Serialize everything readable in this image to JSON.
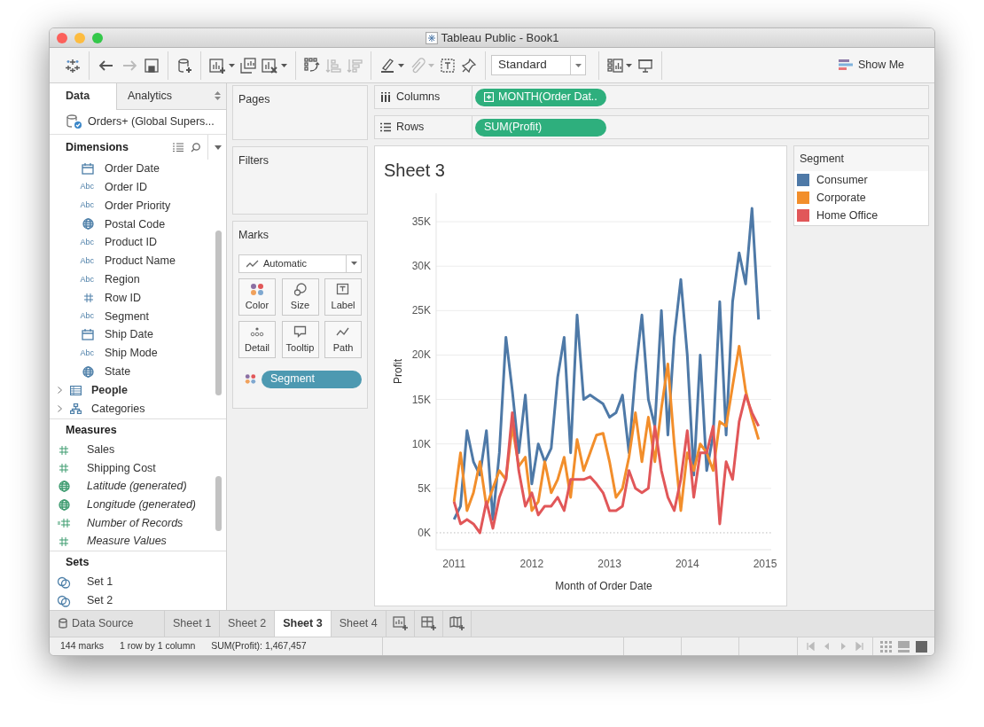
{
  "window": {
    "title": "Tableau Public - Book1"
  },
  "toolbar": {
    "groups": [
      [
        {
          "disabled": false,
          "menu": false
        }
      ],
      [
        {
          "disabled": false,
          "menu": false
        },
        {
          "disabled": true,
          "menu": false
        },
        {
          "disabled": false,
          "menu": false
        }
      ],
      [
        {
          "disabled": false,
          "menu": false
        }
      ],
      [
        {
          "disabled": false,
          "menu": true
        },
        {
          "disabled": false,
          "menu": false
        },
        {
          "disabled": false,
          "menu": true
        }
      ],
      [
        {
          "disabled": false,
          "menu": false
        },
        {
          "disabled": true,
          "menu": false
        },
        {
          "disabled": true,
          "menu": false
        }
      ],
      [
        {
          "disabled": false,
          "menu": true
        },
        {
          "disabled": true,
          "menu": true
        },
        {
          "disabled": false,
          "menu": false
        },
        {
          "disabled": false,
          "menu": false
        }
      ]
    ],
    "fit": {
      "value": "Standard"
    },
    "view_buttons": [
      {
        "disabled": false,
        "menu": true
      },
      {
        "disabled": false,
        "menu": false
      }
    ],
    "show_me": {
      "label": "Show Me"
    }
  },
  "data_pane": {
    "tabs": [
      {
        "label": "Data",
        "selected": true
      },
      {
        "label": "Analytics",
        "selected": false
      }
    ],
    "datasource": "Orders+ (Global Supers...",
    "dimensions": {
      "title": "Dimensions",
      "fields": [
        {
          "name": "Order Date",
          "kind": "date"
        },
        {
          "name": "Order ID",
          "kind": "string",
          "badge": "Abc"
        },
        {
          "name": "Order Priority",
          "kind": "string",
          "badge": "Abc"
        },
        {
          "name": "Postal Code",
          "kind": "geo"
        },
        {
          "name": "Product ID",
          "kind": "string",
          "badge": "Abc"
        },
        {
          "name": "Product Name",
          "kind": "string",
          "badge": "Abc"
        },
        {
          "name": "Region",
          "kind": "string",
          "badge": "Abc"
        },
        {
          "name": "Row ID",
          "kind": "number"
        },
        {
          "name": "Segment",
          "kind": "string",
          "badge": "Abc"
        },
        {
          "name": "Ship Date",
          "kind": "date"
        },
        {
          "name": "Ship Mode",
          "kind": "string",
          "badge": "Abc"
        },
        {
          "name": "State",
          "kind": "geo"
        },
        {
          "name": "People",
          "kind": "folder",
          "expanded": false
        },
        {
          "name": "Categories",
          "kind": "hierarchy",
          "expanded": false
        }
      ]
    },
    "measures": {
      "title": "Measures",
      "fields": [
        {
          "name": "Sales",
          "kind": "number",
          "italic": false
        },
        {
          "name": "Shipping Cost",
          "kind": "number",
          "italic": false
        },
        {
          "name": "Latitude (generated)",
          "kind": "geo",
          "italic": true
        },
        {
          "name": "Longitude (generated)",
          "kind": "geo",
          "italic": true
        },
        {
          "name": "Number of Records",
          "kind": "count",
          "italic": true
        },
        {
          "name": "Measure Values",
          "kind": "number",
          "italic": true
        }
      ]
    },
    "sets": {
      "title": "Sets",
      "items": [
        {
          "name": "Set 1"
        },
        {
          "name": "Set 2"
        }
      ]
    }
  },
  "shelves": {
    "pages": {
      "title": "Pages"
    },
    "filters": {
      "title": "Filters"
    },
    "marks": {
      "title": "Marks",
      "mark_type": "Automatic",
      "cards": [
        {
          "label": "Color",
          "kind": "color"
        },
        {
          "label": "Size",
          "kind": "size"
        },
        {
          "label": "Label",
          "kind": "label"
        },
        {
          "label": "Detail",
          "kind": "detail"
        },
        {
          "label": "Tooltip",
          "kind": "tooltip"
        },
        {
          "label": "Path",
          "kind": "path"
        }
      ],
      "pills": [
        {
          "label": "Segment",
          "kind": "color"
        }
      ]
    },
    "columns": {
      "label": "Columns",
      "pills": [
        {
          "label": "MONTH(Order Dat..",
          "expandable": true
        }
      ]
    },
    "rows": {
      "label": "Rows",
      "pills": [
        {
          "label": "SUM(Profit)",
          "expandable": false
        }
      ]
    }
  },
  "sheet": {
    "title": "Sheet 3",
    "chart_data": {
      "type": "line",
      "xlabel": "Month of Order Date",
      "ylabel": "Profit",
      "x": [
        2011,
        2011.083,
        2011.167,
        2011.25,
        2011.333,
        2011.417,
        2011.5,
        2011.583,
        2011.667,
        2011.75,
        2011.833,
        2011.917,
        2012,
        2012.083,
        2012.167,
        2012.25,
        2012.333,
        2012.417,
        2012.5,
        2012.583,
        2012.667,
        2012.75,
        2012.833,
        2012.917,
        2013,
        2013.083,
        2013.167,
        2013.25,
        2013.333,
        2013.417,
        2013.5,
        2013.583,
        2013.667,
        2013.75,
        2013.833,
        2013.917,
        2014,
        2014.083,
        2014.167,
        2014.25,
        2014.333,
        2014.417,
        2014.5,
        2014.583,
        2014.667,
        2014.75,
        2014.833,
        2014.917
      ],
      "series": [
        {
          "name": "Consumer",
          "color": "#4e79a7",
          "values": [
            1500,
            3000,
            11500,
            8000,
            6500,
            11500,
            1500,
            9000,
            22000,
            16000,
            9000,
            15500,
            5500,
            10000,
            8000,
            9500,
            17500,
            22000,
            9000,
            24500,
            15000,
            15500,
            15000,
            14500,
            13000,
            13500,
            15500,
            9000,
            18000,
            24500,
            15000,
            12000,
            25000,
            11000,
            22000,
            28500,
            20000,
            6500,
            20000,
            7000,
            11000,
            26000,
            11000,
            26000,
            31500,
            28000,
            36500,
            24000
          ]
        },
        {
          "name": "Corporate",
          "color": "#f28e2b",
          "values": [
            3500,
            9000,
            2500,
            4500,
            8000,
            3000,
            5000,
            7000,
            6000,
            12000,
            7500,
            8500,
            2500,
            3500,
            8000,
            4500,
            6000,
            8500,
            4000,
            10500,
            7000,
            9000,
            11000,
            11200,
            8000,
            4000,
            5000,
            8500,
            13500,
            8000,
            13000,
            8000,
            14000,
            19000,
            10000,
            2500,
            9000,
            7000,
            10000,
            9000,
            7000,
            12500,
            12000,
            16500,
            21000,
            16000,
            13000,
            10500
          ]
        },
        {
          "name": "Home Office",
          "color": "#e15759",
          "values": [
            3500,
            1000,
            1500,
            1000,
            0,
            3500,
            500,
            4000,
            6000,
            13500,
            7000,
            3000,
            4500,
            2000,
            3000,
            3000,
            4000,
            2500,
            6000,
            6000,
            6000,
            6300,
            5500,
            4500,
            2500,
            2500,
            3000,
            7000,
            5000,
            4500,
            5000,
            12000,
            7000,
            4000,
            2500,
            6000,
            11500,
            4000,
            9000,
            9000,
            12000,
            1000,
            8000,
            6000,
            12500,
            15500,
            13500,
            12000
          ]
        }
      ],
      "xlim": [
        2010.77,
        2015.08
      ],
      "ylim": [
        -1900,
        38200
      ],
      "grid": true,
      "ref_lines": [
        {
          "axis": "y",
          "value": 0
        }
      ],
      "xticks": [
        2011,
        2012,
        2013,
        2014,
        2015
      ],
      "yticks": [
        {
          "value": 0,
          "label": "0K"
        },
        {
          "value": 5000,
          "label": "5K"
        },
        {
          "value": 10000,
          "label": "10K"
        },
        {
          "value": 15000,
          "label": "15K"
        },
        {
          "value": 20000,
          "label": "20K"
        },
        {
          "value": 25000,
          "label": "25K"
        },
        {
          "value": 30000,
          "label": "30K"
        },
        {
          "value": 35000,
          "label": "35K"
        }
      ]
    }
  },
  "legend": {
    "title": "Segment"
  },
  "sheet_tabs": [
    {
      "label": "Data Source",
      "kind": "datasource",
      "selected": false
    },
    {
      "label": "Sheet 1",
      "kind": "sheet",
      "selected": false
    },
    {
      "label": "Sheet 2",
      "kind": "sheet",
      "selected": false
    },
    {
      "label": "Sheet 3",
      "kind": "sheet",
      "selected": true
    },
    {
      "label": "Sheet 4",
      "kind": "sheet",
      "selected": false
    }
  ],
  "status_bar": [
    "144 marks",
    "1 row by 1 column",
    "SUM(Profit): 1,467,457"
  ]
}
